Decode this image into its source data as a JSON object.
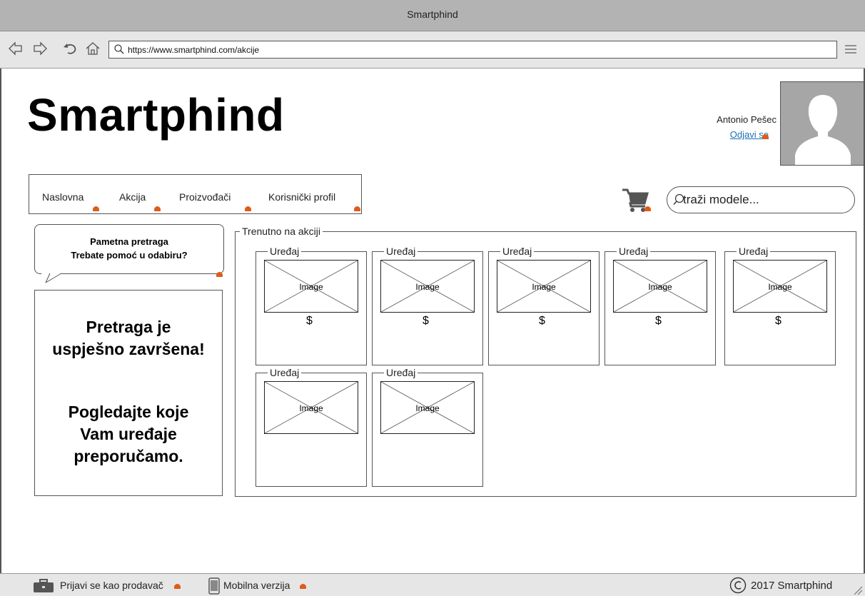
{
  "window": {
    "title": "Smartphind"
  },
  "browser": {
    "url": "https://www.smartphind.com/akcije"
  },
  "header": {
    "logo": "Smartphind",
    "user_name": "Antonio Pešec",
    "logout": "Odjavi se"
  },
  "menu": {
    "items": [
      "Naslovna",
      "Akcija",
      "Proizvođači",
      "Korisnički profil"
    ]
  },
  "search": {
    "placeholder": "traži modele..."
  },
  "sidebar": {
    "bubble_line1": "Pametna pretraga",
    "bubble_line2": "Trebate pomoć u odabiru?",
    "result_line1": "Pretraga je",
    "result_line2": "uspješno završena!",
    "result_line3": "Pogledajte koje",
    "result_line4": "Vam uređaje",
    "result_line5": "preporučamo."
  },
  "deals": {
    "legend": "Trenutno na akciji",
    "cards": [
      {
        "label": "Uređaj",
        "image_text": "Image",
        "icons": [
          "camera-icon",
          "phone-icon",
          "money-icon",
          "storage-icon",
          "music-icon",
          "android-icon",
          "thumbs-up-icon"
        ]
      },
      {
        "label": "Uređaj",
        "image_text": "Image",
        "icons": [
          "camera-icon",
          "phone-icon",
          "money-icon",
          "storage-icon",
          "music-icon",
          "android-icon",
          "thumbs-up-icon"
        ]
      },
      {
        "label": "Uređaj",
        "image_text": "Image",
        "icons": [
          "camera-icon",
          "phone-icon",
          "money-icon",
          "storage-icon",
          "music-icon",
          "android-icon",
          "thumbs-up-icon"
        ]
      },
      {
        "label": "Uređaj",
        "image_text": "Image",
        "icons": [
          "camera-icon",
          "phone-icon",
          "money-icon",
          "storage-icon",
          "music-icon",
          "android-icon",
          "thumbs-up-icon"
        ]
      },
      {
        "label": "Uređaj",
        "image_text": "Image",
        "icons": [
          "camera-icon",
          "phone-icon",
          "money-icon",
          "storage-icon",
          "music-icon",
          "android-icon",
          "thumbs-up-icon"
        ]
      },
      {
        "label": "Uređaj",
        "image_text": "Image",
        "icons": [
          "camera-icon",
          "phone-icon",
          "gamepad-icon",
          "storage-icon",
          "music-icon",
          "android-icon",
          "thumbs-up-icon"
        ]
      },
      {
        "label": "Uređaj",
        "image_text": "Image",
        "icons": [
          "camera-icon",
          "phone-icon",
          "gamepad-icon",
          "storage-icon",
          "music-icon",
          "android-icon",
          "thumbs-up-icon"
        ]
      }
    ]
  },
  "footer": {
    "seller_login": "Prijavi se kao prodavač",
    "mobile": "Mobilna verzija",
    "copyright": "2017 Smartphind"
  },
  "colors": {
    "chrome": "#b3b3b3",
    "toolbar": "#e6e6e6",
    "link": "#1a6fb5",
    "hotspot": "#e05a1a",
    "icon_gray": "#555555"
  }
}
